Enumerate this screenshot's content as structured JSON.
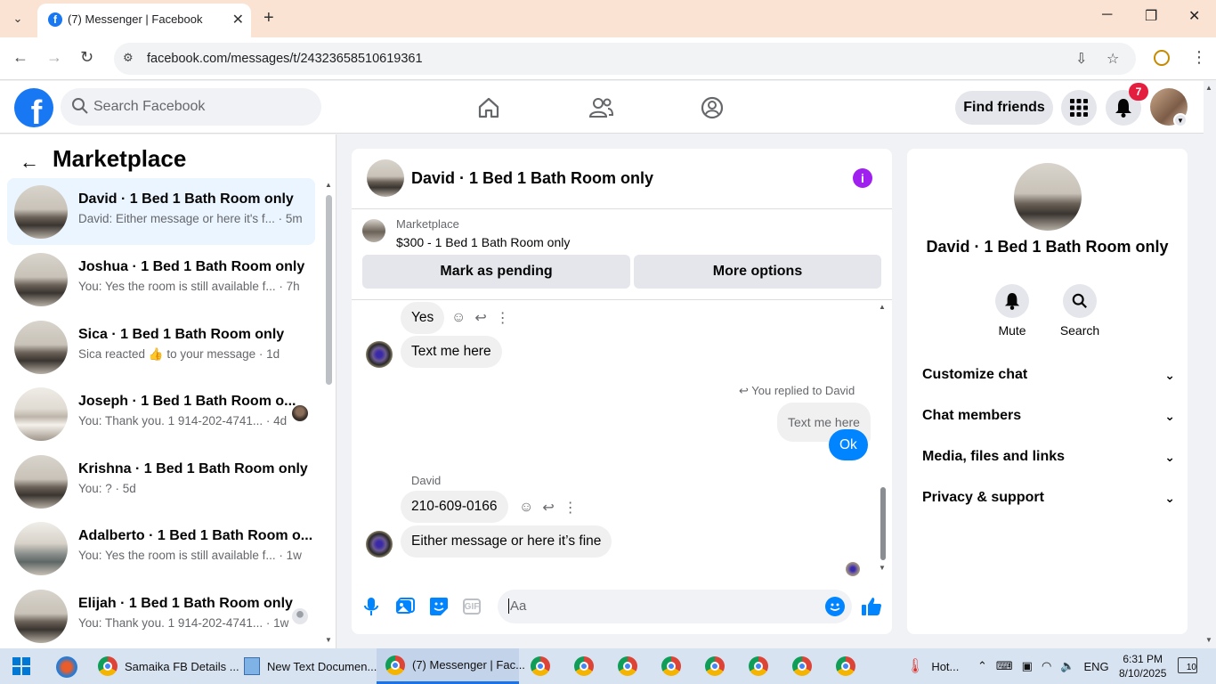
{
  "browser": {
    "tab_title": "(7) Messenger | Facebook",
    "url": "facebook.com/messages/t/24323658510619361"
  },
  "fb": {
    "search_placeholder": "Search Facebook",
    "find_friends": "Find friends",
    "notification_count": "7",
    "brand_color": "#1877f2"
  },
  "left": {
    "title": "Marketplace",
    "conversations": [
      {
        "name": "David · 1 Bed 1 Bath Room only",
        "snippet": "David: Either message or here it's f... · 5m",
        "active": true
      },
      {
        "name": "Joshua · 1 Bed 1 Bath Room only",
        "snippet": "You: Yes the room is still available f... · 7h"
      },
      {
        "name": "Sica · 1 Bed 1 Bath Room only",
        "snippet": "Sica reacted 👍 to your message · 1d"
      },
      {
        "name": "Joseph · 1 Bed 1 Bath Room o...",
        "snippet": "You: Thank you. 1 914-202-4741... · 4d"
      },
      {
        "name": "Krishna · 1 Bed 1 Bath Room only",
        "snippet": "You: ? · 5d"
      },
      {
        "name": "Adalberto · 1 Bed 1 Bath Room o...",
        "snippet": "You: Yes the room is still available f... · 1w"
      },
      {
        "name": "Elijah · 1 Bed 1 Bath Room only",
        "snippet": "You: Thank you. 1 914-202-4741... · 1w"
      }
    ]
  },
  "chat": {
    "title": "David · 1 Bed 1 Bath Room only",
    "marketplace_label": "Marketplace",
    "listing": "$300 - 1 Bed 1 Bath Room only",
    "mark_pending": "Mark as pending",
    "more_options": "More options",
    "messages": {
      "yes": "Yes",
      "text_me": "Text me here",
      "reply_note": "You replied to David",
      "quoted": "Text me here",
      "ok": "Ok",
      "sender": "David",
      "phone": "210-609-0166",
      "either": "Either message or here it’s fine"
    },
    "composer_placeholder": "Aa",
    "gif_label": "GIF"
  },
  "right": {
    "name": "David · 1 Bed 1 Bath Room only",
    "mute": "Mute",
    "search": "Search",
    "sections": [
      "Customize chat",
      "Chat members",
      "Media, files and links",
      "Privacy & support"
    ]
  },
  "taskbar": {
    "item1": "Samaika FB Details ...",
    "item2": "New Text Documen...",
    "item3": "(7) Messenger | Fac...",
    "weather": "Hot...",
    "lang": "ENG",
    "time": "6:31 PM",
    "date": "8/10/2025",
    "notif_count": "10"
  }
}
